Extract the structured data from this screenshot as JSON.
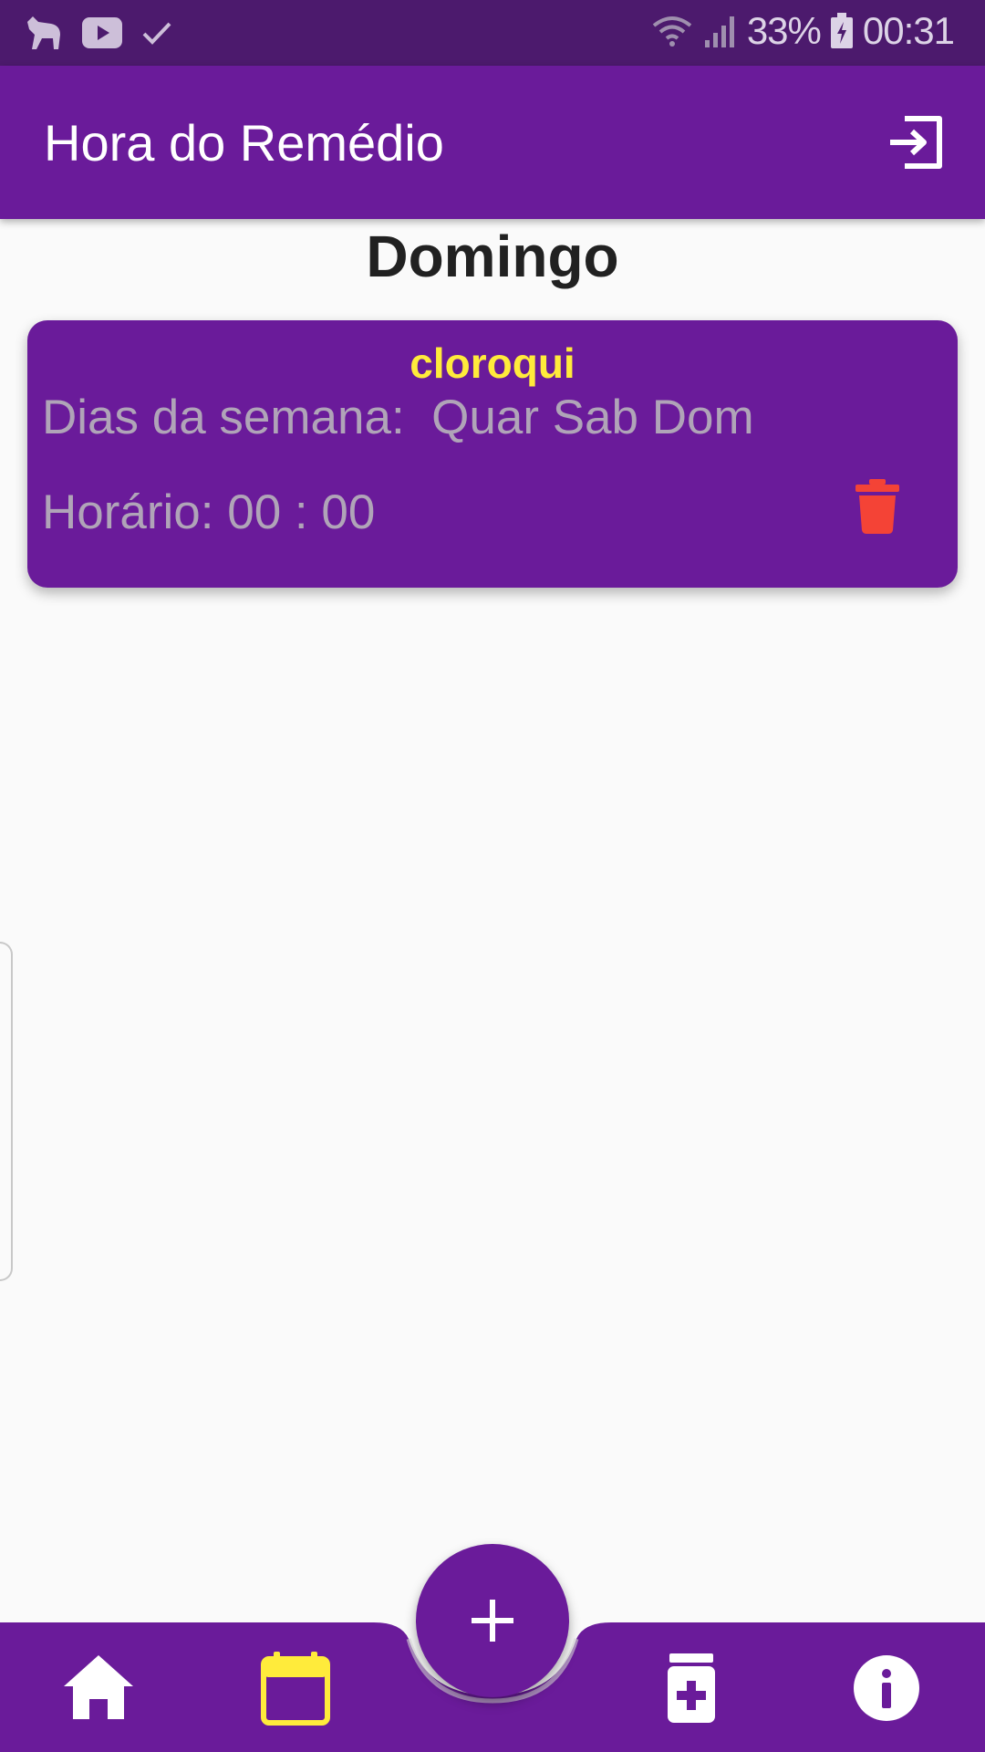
{
  "status_bar": {
    "battery": "33%",
    "time": "00:31",
    "icons": [
      "pet-app-icon",
      "youtube-icon",
      "check-icon",
      "wifi-icon",
      "signal-icon",
      "battery-icon"
    ]
  },
  "app_bar": {
    "title": "Hora do Remédio",
    "action_icon": "exit-icon"
  },
  "day": "Domingo",
  "reminders": [
    {
      "name": "cloroqui",
      "days_text": "Dias da semana:  Quar Sab Dom",
      "time_text": "Horário: 00 : 00",
      "delete_icon": "trash-icon"
    }
  ],
  "bottom_nav": {
    "items": [
      {
        "icon": "home-icon",
        "active": false
      },
      {
        "icon": "calendar-icon",
        "active": true
      },
      {
        "icon": "medicine-icon",
        "active": false
      },
      {
        "icon": "info-icon",
        "active": false
      }
    ],
    "fab_icon": "plus-icon"
  },
  "colors": {
    "primary": "#6a1b9a",
    "status_bar": "#4c1a6d",
    "accent": "#ffeb3b",
    "danger": "#f44336",
    "background": "#fafafa"
  }
}
